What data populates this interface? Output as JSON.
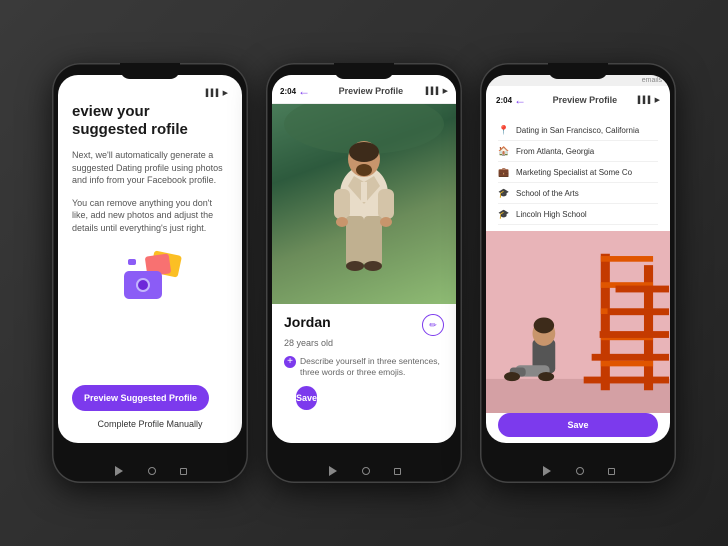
{
  "scene": {
    "background_color": "#2a2a2a"
  },
  "phone1": {
    "status_bar": "▌▌▌▌ ▶",
    "title": "eview your suggested\nrofile",
    "body1": "Next, we'll automatically generate a suggested Dating profile using photos and info from your Facebook profile.",
    "body2": "You can remove anything you don't like, add new photos and adjust the details until everything's just right.",
    "btn_primary": "Preview Suggested Profile",
    "btn_secondary": "Complete Profile Manually",
    "nav": [
      "◁",
      "○",
      "□"
    ]
  },
  "phone2": {
    "status_time": "2:04",
    "status_icons": "▌▌▌ ▶",
    "header_title": "Preview Profile",
    "profile_name": "Jordan",
    "profile_age": "28 years old",
    "describe_placeholder": "Describe yourself in three sentences, three words or three emojis.",
    "save_label": "Save",
    "nav": [
      "◁",
      "○",
      "□"
    ]
  },
  "phone3": {
    "status_time": "2:04",
    "status_icons": "▌▌▌ ▶",
    "header_title": "Preview Profile",
    "top_notification": "emails",
    "info_rows": [
      {
        "icon": "📍",
        "text": "Dating in San Francisco, California"
      },
      {
        "icon": "🏠",
        "text": "From Atlanta, Georgia"
      },
      {
        "icon": "💼",
        "text": "Marketing Specialist at Some Co"
      },
      {
        "icon": "🎓",
        "text": "School of the Arts"
      },
      {
        "icon": "🎓",
        "text": "Lincoln High School"
      }
    ],
    "school_of_arts": "School of the Arts",
    "lincoln_school": "Lincoln High School",
    "save_label": "Save",
    "nav": [
      "◁",
      "○",
      "□"
    ]
  }
}
